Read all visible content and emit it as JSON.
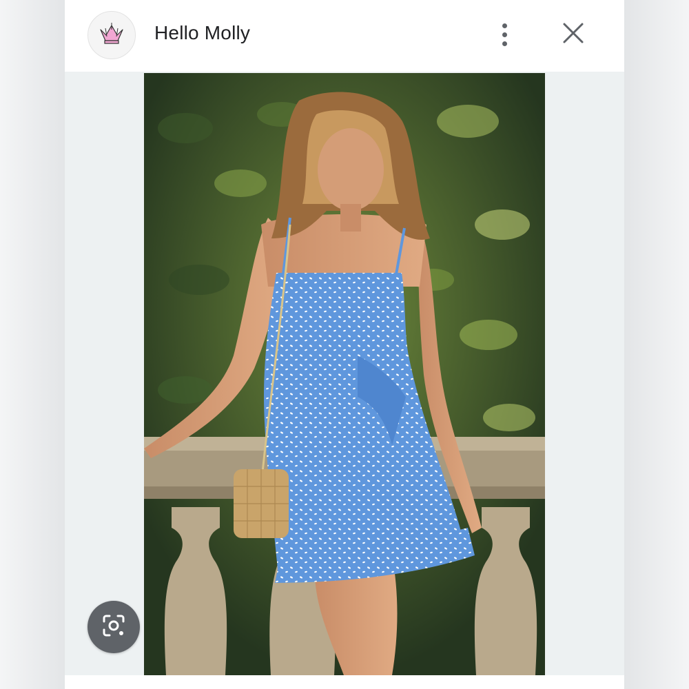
{
  "header": {
    "title": "Hello Molly",
    "logo_icon": "crown-icon",
    "more_icon": "more-vert-icon",
    "close_icon": "close-icon"
  },
  "image": {
    "subject": "product-photo",
    "lens_icon": "lens-icon"
  },
  "colors": {
    "header_bg": "#ffffff",
    "panel_bg": "#edf1f2",
    "icon_gray": "#5f6368",
    "crown_pink": "#f2a7d3"
  }
}
